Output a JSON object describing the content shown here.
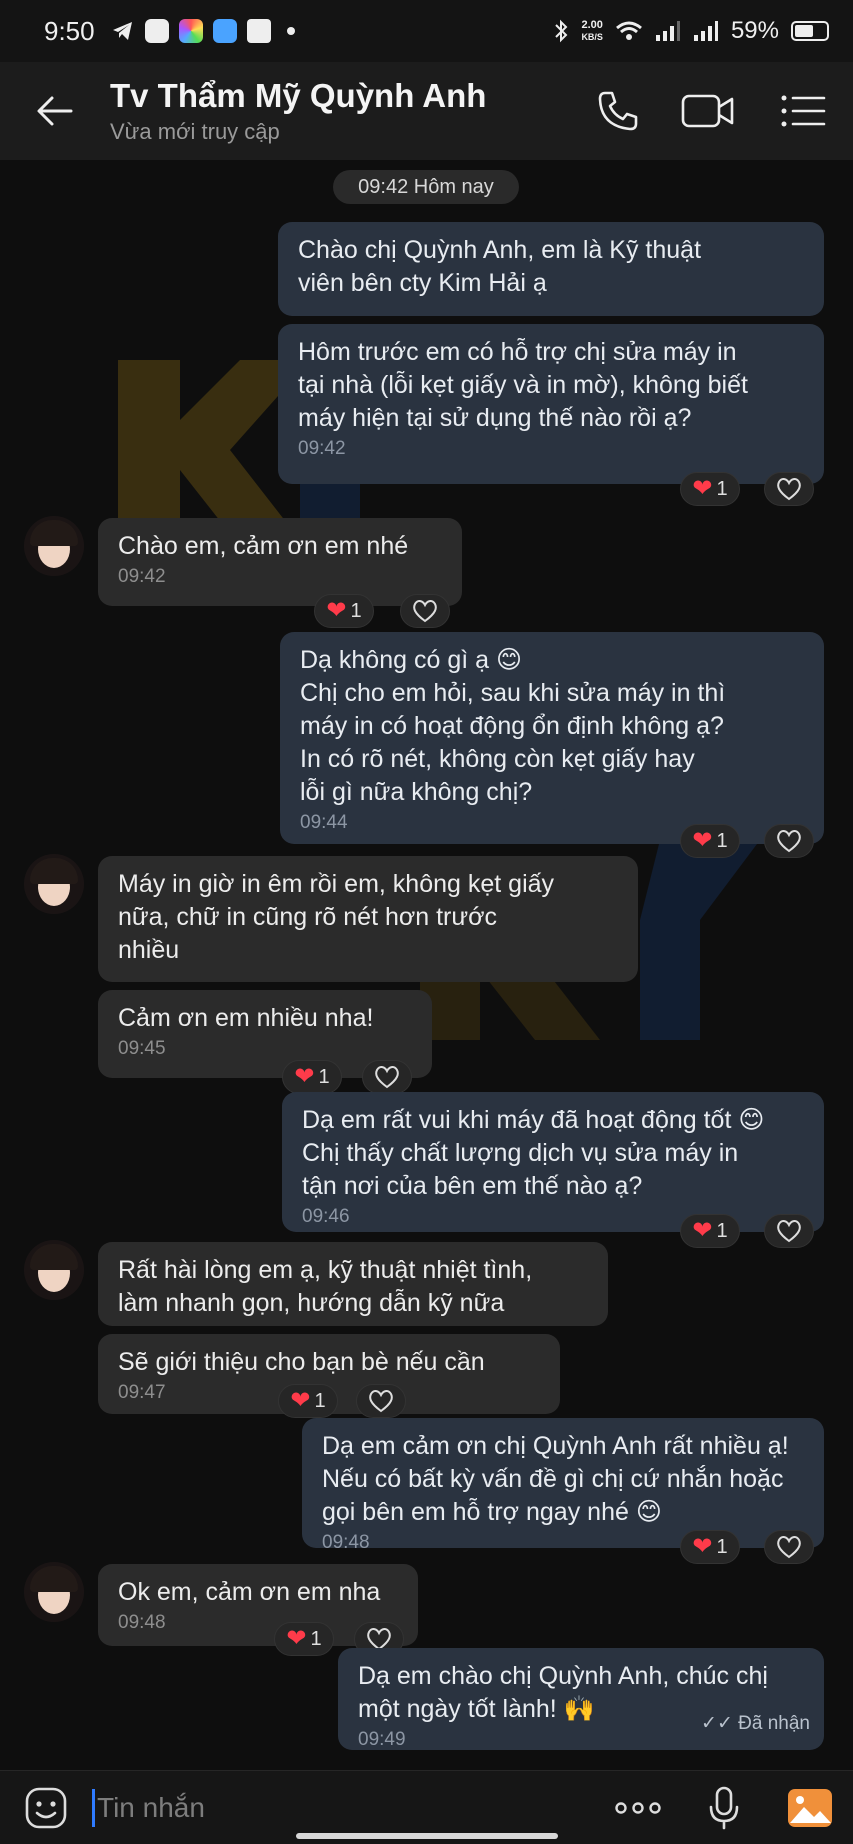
{
  "status_bar": {
    "time": "9:50",
    "net_speed_value": "2.00",
    "net_speed_unit": "KB/S",
    "battery": "59%",
    "battery_level": 0.59
  },
  "header": {
    "title": "Tv Thẩm Mỹ Quỳnh Anh",
    "subtitle": "Vừa mới truy cập"
  },
  "date_separator": "09:42 Hôm nay",
  "messages": [
    {
      "dir": "out",
      "lines": [
        "Chào chị Quỳnh Anh, em là Kỹ thuật",
        "viên bên cty Kim Hải ạ"
      ],
      "time": ""
    },
    {
      "dir": "out",
      "lines": [
        "Hôm trước em có hỗ trợ chị sửa máy in",
        "tại nhà (lỗi kẹt giấy và in mờ), không biết",
        "máy hiện tại sử dụng thế nào rồi ạ?"
      ],
      "time": "09:42",
      "reactions": "1"
    },
    {
      "dir": "in",
      "lines": [
        "Chào em, cảm ơn em nhé"
      ],
      "time": "09:42",
      "reactions": "1"
    },
    {
      "dir": "out",
      "lines": [
        "Dạ không có gì ạ 😊",
        "Chị cho em hỏi, sau khi sửa máy in thì",
        "máy in có hoạt động ổn định không ạ?",
        "In có rõ nét, không còn kẹt giấy hay",
        "lỗi gì nữa không chị?"
      ],
      "time": "09:44",
      "reactions": "1"
    },
    {
      "dir": "in",
      "lines": [
        "Máy in giờ in êm rồi em, không kẹt giấy",
        "nữa, chữ in cũng rõ nét hơn trước",
        "nhiều"
      ],
      "time": ""
    },
    {
      "dir": "in",
      "lines": [
        "Cảm ơn em nhiều nha!"
      ],
      "time": "09:45",
      "reactions": "1"
    },
    {
      "dir": "out",
      "lines": [
        "Dạ em rất vui khi máy đã hoạt động tốt 😊",
        "Chị thấy chất lượng dịch vụ sửa máy in",
        "tận nơi của bên em thế nào ạ?"
      ],
      "time": "09:46",
      "reactions": "1"
    },
    {
      "dir": "in",
      "lines": [
        "Rất hài lòng em ạ, kỹ thuật nhiệt tình,",
        "làm nhanh gọn, hướng dẫn kỹ nữa"
      ],
      "time": ""
    },
    {
      "dir": "in",
      "lines": [
        "Sẽ giới thiệu cho bạn bè nếu cần"
      ],
      "time": "09:47",
      "reactions": "1"
    },
    {
      "dir": "out",
      "lines": [
        "Dạ em cảm ơn chị Quỳnh Anh rất nhiều ạ!",
        "Nếu có bất kỳ vấn đề gì chị cứ nhắn hoặc",
        "gọi bên em hỗ trợ ngay nhé 😊"
      ],
      "time": "09:48",
      "reactions": "1"
    },
    {
      "dir": "in",
      "lines": [
        "Ok em, cảm ơn em nha"
      ],
      "time": "09:48",
      "reactions": "1"
    },
    {
      "dir": "out",
      "lines": [
        "Dạ em chào chị Quỳnh Anh, chúc chị",
        "một ngày tốt lành! 🙌"
      ],
      "time": "09:49",
      "status": "✓✓ Đã nhận"
    }
  ],
  "input": {
    "placeholder": "Tin nhắn"
  },
  "colors": {
    "out_bubble": "#2a3340",
    "in_bubble": "#2b2b2b",
    "accent": "#2f7bff",
    "heart": "#ff3b4a"
  },
  "icons": [
    "back-arrow-icon",
    "phone-icon",
    "video-icon",
    "menu-list-icon",
    "heart-icon",
    "emoji-icon",
    "more-icon",
    "mic-icon",
    "image-icon"
  ]
}
